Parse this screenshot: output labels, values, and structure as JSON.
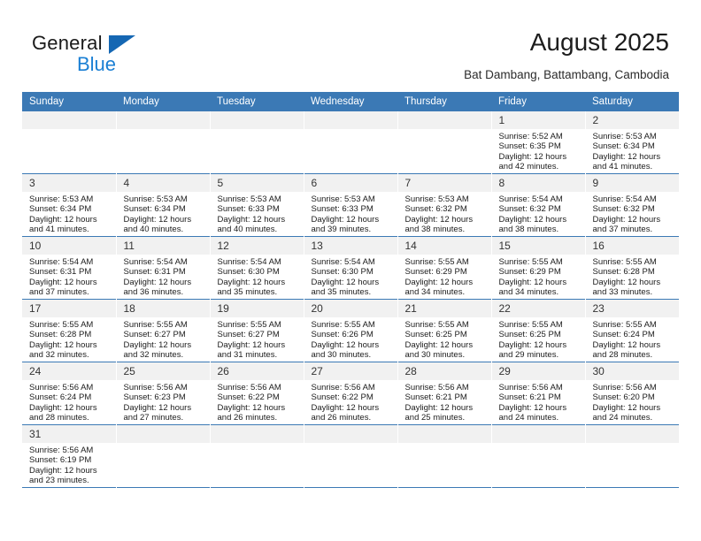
{
  "logo": {
    "word_one": "General",
    "word_two": "Blue",
    "flag_icon": "blue-triangle-flag",
    "accent_dark": "#1567b3",
    "accent_light": "#1a7fd4"
  },
  "header": {
    "title": "August 2025",
    "subtitle": "Bat Dambang, Battambang, Cambodia"
  },
  "theme": {
    "header_row_bg": "#3b79b5",
    "daynum_bg": "#f1f1f1",
    "grid_line": "#3b79b5"
  },
  "weekdays": [
    "Sunday",
    "Monday",
    "Tuesday",
    "Wednesday",
    "Thursday",
    "Friday",
    "Saturday"
  ],
  "weeks": [
    [
      {
        "day": "",
        "lines": []
      },
      {
        "day": "",
        "lines": []
      },
      {
        "day": "",
        "lines": []
      },
      {
        "day": "",
        "lines": []
      },
      {
        "day": "",
        "lines": []
      },
      {
        "day": "1",
        "lines": [
          "Sunrise: 5:52 AM",
          "Sunset: 6:35 PM",
          "Daylight: 12 hours",
          "and 42 minutes."
        ]
      },
      {
        "day": "2",
        "lines": [
          "Sunrise: 5:53 AM",
          "Sunset: 6:34 PM",
          "Daylight: 12 hours",
          "and 41 minutes."
        ]
      }
    ],
    [
      {
        "day": "3",
        "lines": [
          "Sunrise: 5:53 AM",
          "Sunset: 6:34 PM",
          "Daylight: 12 hours",
          "and 41 minutes."
        ]
      },
      {
        "day": "4",
        "lines": [
          "Sunrise: 5:53 AM",
          "Sunset: 6:34 PM",
          "Daylight: 12 hours",
          "and 40 minutes."
        ]
      },
      {
        "day": "5",
        "lines": [
          "Sunrise: 5:53 AM",
          "Sunset: 6:33 PM",
          "Daylight: 12 hours",
          "and 40 minutes."
        ]
      },
      {
        "day": "6",
        "lines": [
          "Sunrise: 5:53 AM",
          "Sunset: 6:33 PM",
          "Daylight: 12 hours",
          "and 39 minutes."
        ]
      },
      {
        "day": "7",
        "lines": [
          "Sunrise: 5:53 AM",
          "Sunset: 6:32 PM",
          "Daylight: 12 hours",
          "and 38 minutes."
        ]
      },
      {
        "day": "8",
        "lines": [
          "Sunrise: 5:54 AM",
          "Sunset: 6:32 PM",
          "Daylight: 12 hours",
          "and 38 minutes."
        ]
      },
      {
        "day": "9",
        "lines": [
          "Sunrise: 5:54 AM",
          "Sunset: 6:32 PM",
          "Daylight: 12 hours",
          "and 37 minutes."
        ]
      }
    ],
    [
      {
        "day": "10",
        "lines": [
          "Sunrise: 5:54 AM",
          "Sunset: 6:31 PM",
          "Daylight: 12 hours",
          "and 37 minutes."
        ]
      },
      {
        "day": "11",
        "lines": [
          "Sunrise: 5:54 AM",
          "Sunset: 6:31 PM",
          "Daylight: 12 hours",
          "and 36 minutes."
        ]
      },
      {
        "day": "12",
        "lines": [
          "Sunrise: 5:54 AM",
          "Sunset: 6:30 PM",
          "Daylight: 12 hours",
          "and 35 minutes."
        ]
      },
      {
        "day": "13",
        "lines": [
          "Sunrise: 5:54 AM",
          "Sunset: 6:30 PM",
          "Daylight: 12 hours",
          "and 35 minutes."
        ]
      },
      {
        "day": "14",
        "lines": [
          "Sunrise: 5:55 AM",
          "Sunset: 6:29 PM",
          "Daylight: 12 hours",
          "and 34 minutes."
        ]
      },
      {
        "day": "15",
        "lines": [
          "Sunrise: 5:55 AM",
          "Sunset: 6:29 PM",
          "Daylight: 12 hours",
          "and 34 minutes."
        ]
      },
      {
        "day": "16",
        "lines": [
          "Sunrise: 5:55 AM",
          "Sunset: 6:28 PM",
          "Daylight: 12 hours",
          "and 33 minutes."
        ]
      }
    ],
    [
      {
        "day": "17",
        "lines": [
          "Sunrise: 5:55 AM",
          "Sunset: 6:28 PM",
          "Daylight: 12 hours",
          "and 32 minutes."
        ]
      },
      {
        "day": "18",
        "lines": [
          "Sunrise: 5:55 AM",
          "Sunset: 6:27 PM",
          "Daylight: 12 hours",
          "and 32 minutes."
        ]
      },
      {
        "day": "19",
        "lines": [
          "Sunrise: 5:55 AM",
          "Sunset: 6:27 PM",
          "Daylight: 12 hours",
          "and 31 minutes."
        ]
      },
      {
        "day": "20",
        "lines": [
          "Sunrise: 5:55 AM",
          "Sunset: 6:26 PM",
          "Daylight: 12 hours",
          "and 30 minutes."
        ]
      },
      {
        "day": "21",
        "lines": [
          "Sunrise: 5:55 AM",
          "Sunset: 6:25 PM",
          "Daylight: 12 hours",
          "and 30 minutes."
        ]
      },
      {
        "day": "22",
        "lines": [
          "Sunrise: 5:55 AM",
          "Sunset: 6:25 PM",
          "Daylight: 12 hours",
          "and 29 minutes."
        ]
      },
      {
        "day": "23",
        "lines": [
          "Sunrise: 5:55 AM",
          "Sunset: 6:24 PM",
          "Daylight: 12 hours",
          "and 28 minutes."
        ]
      }
    ],
    [
      {
        "day": "24",
        "lines": [
          "Sunrise: 5:56 AM",
          "Sunset: 6:24 PM",
          "Daylight: 12 hours",
          "and 28 minutes."
        ]
      },
      {
        "day": "25",
        "lines": [
          "Sunrise: 5:56 AM",
          "Sunset: 6:23 PM",
          "Daylight: 12 hours",
          "and 27 minutes."
        ]
      },
      {
        "day": "26",
        "lines": [
          "Sunrise: 5:56 AM",
          "Sunset: 6:22 PM",
          "Daylight: 12 hours",
          "and 26 minutes."
        ]
      },
      {
        "day": "27",
        "lines": [
          "Sunrise: 5:56 AM",
          "Sunset: 6:22 PM",
          "Daylight: 12 hours",
          "and 26 minutes."
        ]
      },
      {
        "day": "28",
        "lines": [
          "Sunrise: 5:56 AM",
          "Sunset: 6:21 PM",
          "Daylight: 12 hours",
          "and 25 minutes."
        ]
      },
      {
        "day": "29",
        "lines": [
          "Sunrise: 5:56 AM",
          "Sunset: 6:21 PM",
          "Daylight: 12 hours",
          "and 24 minutes."
        ]
      },
      {
        "day": "30",
        "lines": [
          "Sunrise: 5:56 AM",
          "Sunset: 6:20 PM",
          "Daylight: 12 hours",
          "and 24 minutes."
        ]
      }
    ],
    [
      {
        "day": "31",
        "lines": [
          "Sunrise: 5:56 AM",
          "Sunset: 6:19 PM",
          "Daylight: 12 hours",
          "and 23 minutes."
        ]
      },
      {
        "day": "",
        "lines": []
      },
      {
        "day": "",
        "lines": []
      },
      {
        "day": "",
        "lines": []
      },
      {
        "day": "",
        "lines": []
      },
      {
        "day": "",
        "lines": []
      },
      {
        "day": "",
        "lines": []
      }
    ]
  ]
}
